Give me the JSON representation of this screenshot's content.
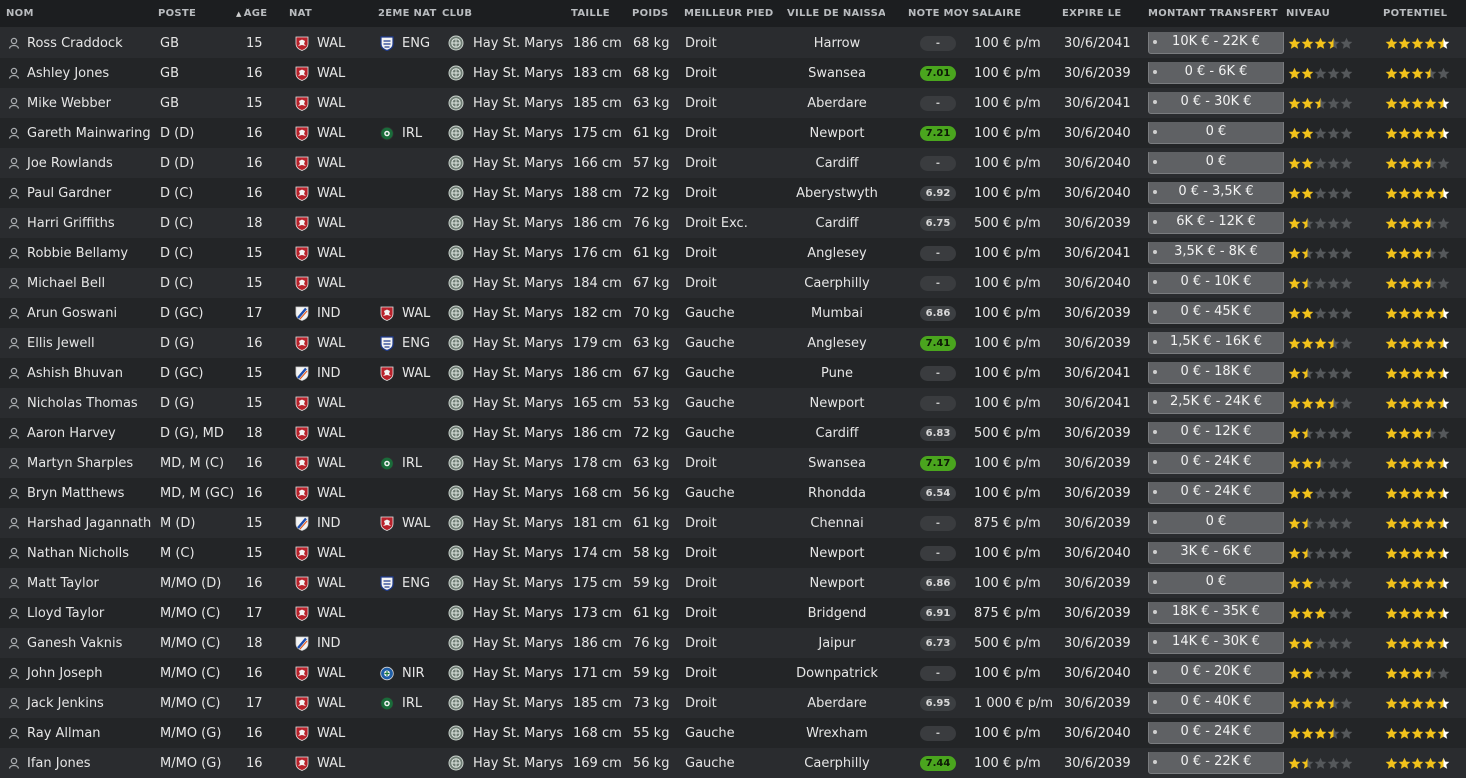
{
  "headers": {
    "name": "NOM",
    "position": "POSTE",
    "age": "ÂGE",
    "nat": "NAT",
    "nat2": "2ÈME NAT",
    "club": "CLUB",
    "height": "TAILLE",
    "weight": "POIDS",
    "foot": "MEILLEUR PIED",
    "birthplace": "VILLE DE NAISSANCE",
    "rating": "NOTE MOY",
    "salary": "SALAIRE",
    "expires": "EXPIRE LE",
    "fee": "MONTANT TRANSFERT",
    "level": "NIVEAU",
    "potential": "POTENTIEL",
    "sort_indicator": "▲"
  },
  "colors": {
    "star_full": "#f2c21b",
    "star_empty": "#55585b",
    "star_white": "#ffffff",
    "rating_good": "#4aa51e",
    "row_odd": "#2a2c2f",
    "row_even": "#232527"
  },
  "players": [
    {
      "name": "Ross Craddock",
      "pos": "GB",
      "age": "15",
      "nat": "WAL",
      "nat2": "ENG",
      "club": "Hay St. Marys",
      "height": "186 cm",
      "weight": "68 kg",
      "foot": "Droit",
      "city": "Harrow",
      "rating": "-",
      "salary": "100 € p/m",
      "expires": "30/6/2041",
      "fee": "10K € - 22K €",
      "level": 3.5,
      "potential": 4.5,
      "pot_white": 1
    },
    {
      "name": "Ashley Jones",
      "pos": "GB",
      "age": "16",
      "nat": "WAL",
      "nat2": "",
      "club": "Hay St. Marys",
      "height": "183 cm",
      "weight": "68 kg",
      "foot": "Droit",
      "city": "Swansea",
      "rating": "7.01",
      "salary": "100 € p/m",
      "expires": "30/6/2039",
      "fee": "0 € - 6K €",
      "level": 2,
      "potential": 3.5,
      "pot_white": 0
    },
    {
      "name": "Mike Webber",
      "pos": "GB",
      "age": "15",
      "nat": "WAL",
      "nat2": "",
      "club": "Hay St. Marys",
      "height": "185 cm",
      "weight": "63 kg",
      "foot": "Droit",
      "city": "Aberdare",
      "rating": "-",
      "salary": "100 € p/m",
      "expires": "30/6/2041",
      "fee": "0 € - 30K €",
      "level": 2.5,
      "potential": 4.5,
      "pot_white": 1
    },
    {
      "name": "Gareth Mainwaring",
      "pos": "D (D)",
      "age": "16",
      "nat": "WAL",
      "nat2": "IRL",
      "club": "Hay St. Marys",
      "height": "175 cm",
      "weight": "61 kg",
      "foot": "Droit",
      "city": "Newport",
      "rating": "7.21",
      "salary": "100 € p/m",
      "expires": "30/6/2040",
      "fee": "0 €",
      "level": 2,
      "potential": 4.5,
      "pot_white": 1
    },
    {
      "name": "Joe Rowlands",
      "pos": "D (D)",
      "age": "16",
      "nat": "WAL",
      "nat2": "",
      "club": "Hay St. Marys",
      "height": "166 cm",
      "weight": "57 kg",
      "foot": "Droit",
      "city": "Cardiff",
      "rating": "-",
      "salary": "100 € p/m",
      "expires": "30/6/2040",
      "fee": "0 €",
      "level": 2,
      "potential": 3.5,
      "pot_white": 0
    },
    {
      "name": "Paul Gardner",
      "pos": "D (C)",
      "age": "16",
      "nat": "WAL",
      "nat2": "",
      "club": "Hay St. Marys",
      "height": "188 cm",
      "weight": "72 kg",
      "foot": "Droit",
      "city": "Aberystwyth",
      "rating": "6.92",
      "salary": "100 € p/m",
      "expires": "30/6/2040",
      "fee": "0 € - 3,5K €",
      "level": 2,
      "potential": 4.5,
      "pot_white": 1
    },
    {
      "name": "Harri Griffiths",
      "pos": "D (C)",
      "age": "18",
      "nat": "WAL",
      "nat2": "",
      "club": "Hay St. Marys",
      "height": "186 cm",
      "weight": "76 kg",
      "foot": "Droit Exc.",
      "city": "Cardiff",
      "rating": "6.75",
      "salary": "500 € p/m",
      "expires": "30/6/2039",
      "fee": "6K € - 12K €",
      "level": 1.5,
      "potential": 3.5,
      "pot_white": 0
    },
    {
      "name": "Robbie Bellamy",
      "pos": "D (C)",
      "age": "15",
      "nat": "WAL",
      "nat2": "",
      "club": "Hay St. Marys",
      "height": "176 cm",
      "weight": "61 kg",
      "foot": "Droit",
      "city": "Anglesey",
      "rating": "-",
      "salary": "100 € p/m",
      "expires": "30/6/2041",
      "fee": "3,5K € - 8K €",
      "level": 1.5,
      "potential": 3.5,
      "pot_white": 0
    },
    {
      "name": "Michael Bell",
      "pos": "D (C)",
      "age": "15",
      "nat": "WAL",
      "nat2": "",
      "club": "Hay St. Marys",
      "height": "184 cm",
      "weight": "67 kg",
      "foot": "Droit",
      "city": "Caerphilly",
      "rating": "-",
      "salary": "100 € p/m",
      "expires": "30/6/2040",
      "fee": "0 € - 10K €",
      "level": 1.5,
      "potential": 3.5,
      "pot_white": 0
    },
    {
      "name": "Arun Goswani",
      "pos": "D (GC)",
      "age": "17",
      "nat": "IND",
      "nat2": "WAL",
      "club": "Hay St. Marys",
      "height": "182 cm",
      "weight": "70 kg",
      "foot": "Gauche",
      "city": "Mumbai",
      "rating": "6.86",
      "salary": "100 € p/m",
      "expires": "30/6/2039",
      "fee": "0 € - 45K €",
      "level": 2,
      "potential": 4.5,
      "pot_white": 1
    },
    {
      "name": "Ellis Jewell",
      "pos": "D (G)",
      "age": "16",
      "nat": "WAL",
      "nat2": "ENG",
      "club": "Hay St. Marys",
      "height": "179 cm",
      "weight": "63 kg",
      "foot": "Gauche",
      "city": "Anglesey",
      "rating": "7.41",
      "salary": "100 € p/m",
      "expires": "30/6/2039",
      "fee": "1,5K € - 16K €",
      "level": 3.5,
      "potential": 4.5,
      "pot_white": 1
    },
    {
      "name": "Ashish Bhuvan",
      "pos": "D (GC)",
      "age": "15",
      "nat": "IND",
      "nat2": "WAL",
      "club": "Hay St. Marys",
      "height": "186 cm",
      "weight": "67 kg",
      "foot": "Gauche",
      "city": "Pune",
      "rating": "-",
      "salary": "100 € p/m",
      "expires": "30/6/2041",
      "fee": "0 € - 18K €",
      "level": 1.5,
      "potential": 4.5,
      "pot_white": 1
    },
    {
      "name": "Nicholas Thomas",
      "pos": "D (G)",
      "age": "15",
      "nat": "WAL",
      "nat2": "",
      "club": "Hay St. Marys",
      "height": "165 cm",
      "weight": "53 kg",
      "foot": "Gauche",
      "city": "Newport",
      "rating": "-",
      "salary": "100 € p/m",
      "expires": "30/6/2041",
      "fee": "2,5K € - 24K €",
      "level": 3.5,
      "potential": 4.5,
      "pot_white": 1
    },
    {
      "name": "Aaron Harvey",
      "pos": "D (G), MD",
      "age": "18",
      "nat": "WAL",
      "nat2": "",
      "club": "Hay St. Marys",
      "height": "186 cm",
      "weight": "72 kg",
      "foot": "Gauche",
      "city": "Cardiff",
      "rating": "6.83",
      "salary": "500 € p/m",
      "expires": "30/6/2039",
      "fee": "0 € - 12K €",
      "level": 1.5,
      "potential": 3.5,
      "pot_white": 0
    },
    {
      "name": "Martyn Sharples",
      "pos": "MD, M (C)",
      "age": "16",
      "nat": "WAL",
      "nat2": "IRL",
      "club": "Hay St. Marys",
      "height": "178 cm",
      "weight": "63 kg",
      "foot": "Droit",
      "city": "Swansea",
      "rating": "7.17",
      "salary": "100 € p/m",
      "expires": "30/6/2039",
      "fee": "0 € - 24K €",
      "level": 2.5,
      "potential": 4.5,
      "pot_white": 1
    },
    {
      "name": "Bryn Matthews",
      "pos": "MD, M (GC)",
      "age": "16",
      "nat": "WAL",
      "nat2": "",
      "club": "Hay St. Marys",
      "height": "168 cm",
      "weight": "56 kg",
      "foot": "Gauche",
      "city": "Rhondda",
      "rating": "6.54",
      "salary": "100 € p/m",
      "expires": "30/6/2039",
      "fee": "0 € - 24K €",
      "level": 2,
      "potential": 4.5,
      "pot_white": 1
    },
    {
      "name": "Harshad Jagannath",
      "pos": "M (D)",
      "age": "15",
      "nat": "IND",
      "nat2": "WAL",
      "club": "Hay St. Marys",
      "height": "181 cm",
      "weight": "61 kg",
      "foot": "Droit",
      "city": "Chennai",
      "rating": "-",
      "salary": "875 € p/m",
      "expires": "30/6/2039",
      "fee": "0 €",
      "level": 1.5,
      "potential": 4.5,
      "pot_white": 1
    },
    {
      "name": "Nathan Nicholls",
      "pos": "M (C)",
      "age": "15",
      "nat": "WAL",
      "nat2": "",
      "club": "Hay St. Marys",
      "height": "174 cm",
      "weight": "58 kg",
      "foot": "Droit",
      "city": "Newport",
      "rating": "-",
      "salary": "100 € p/m",
      "expires": "30/6/2040",
      "fee": "3K € - 6K €",
      "level": 1.5,
      "potential": 4.5,
      "pot_white": 1
    },
    {
      "name": "Matt Taylor",
      "pos": "M/MO (D)",
      "age": "16",
      "nat": "WAL",
      "nat2": "ENG",
      "club": "Hay St. Marys",
      "height": "175 cm",
      "weight": "59 kg",
      "foot": "Droit",
      "city": "Newport",
      "rating": "6.86",
      "salary": "100 € p/m",
      "expires": "30/6/2039",
      "fee": "0 €",
      "level": 2,
      "potential": 4.5,
      "pot_white": 1
    },
    {
      "name": "Lloyd Taylor",
      "pos": "M/MO (C)",
      "age": "17",
      "nat": "WAL",
      "nat2": "",
      "club": "Hay St. Marys",
      "height": "173 cm",
      "weight": "61 kg",
      "foot": "Droit",
      "city": "Bridgend",
      "rating": "6.91",
      "salary": "875 € p/m",
      "expires": "30/6/2039",
      "fee": "18K € - 35K €",
      "level": 3,
      "potential": 4.5,
      "pot_white": 1
    },
    {
      "name": "Ganesh Vaknis",
      "pos": "M/MO (C)",
      "age": "18",
      "nat": "IND",
      "nat2": "",
      "club": "Hay St. Marys",
      "height": "186 cm",
      "weight": "76 kg",
      "foot": "Droit",
      "city": "Jaipur",
      "rating": "6.73",
      "salary": "500 € p/m",
      "expires": "30/6/2039",
      "fee": "14K € - 30K €",
      "level": 2,
      "potential": 4.5,
      "pot_white": 1
    },
    {
      "name": "John Joseph",
      "pos": "M/MO (C)",
      "age": "16",
      "nat": "WAL",
      "nat2": "NIR",
      "club": "Hay St. Marys",
      "height": "171 cm",
      "weight": "59 kg",
      "foot": "Droit",
      "city": "Downpatrick",
      "rating": "-",
      "salary": "100 € p/m",
      "expires": "30/6/2040",
      "fee": "0 € - 20K €",
      "level": 2,
      "potential": 3.5,
      "pot_white": 0
    },
    {
      "name": "Jack Jenkins",
      "pos": "M/MO (C)",
      "age": "17",
      "nat": "WAL",
      "nat2": "IRL",
      "club": "Hay St. Marys",
      "height": "185 cm",
      "weight": "73 kg",
      "foot": "Droit",
      "city": "Aberdare",
      "rating": "6.95",
      "salary": "1 000 € p/m",
      "expires": "30/6/2039",
      "fee": "0 € - 40K €",
      "level": 3.5,
      "potential": 4.5,
      "pot_white": 1
    },
    {
      "name": "Ray Allman",
      "pos": "M/MO (G)",
      "age": "16",
      "nat": "WAL",
      "nat2": "",
      "club": "Hay St. Marys",
      "height": "168 cm",
      "weight": "55 kg",
      "foot": "Gauche",
      "city": "Wrexham",
      "rating": "-",
      "salary": "100 € p/m",
      "expires": "30/6/2040",
      "fee": "0 € - 24K €",
      "level": 3.5,
      "potential": 4.5,
      "pot_white": 1
    },
    {
      "name": "Ifan Jones",
      "pos": "M/MO (G)",
      "age": "16",
      "nat": "WAL",
      "nat2": "",
      "club": "Hay St. Marys",
      "height": "169 cm",
      "weight": "56 kg",
      "foot": "Gauche",
      "city": "Caerphilly",
      "rating": "7.44",
      "salary": "100 € p/m",
      "expires": "30/6/2039",
      "fee": "0 € - 22K €",
      "level": 1.5,
      "potential": 4.5,
      "pot_white": 1
    }
  ]
}
